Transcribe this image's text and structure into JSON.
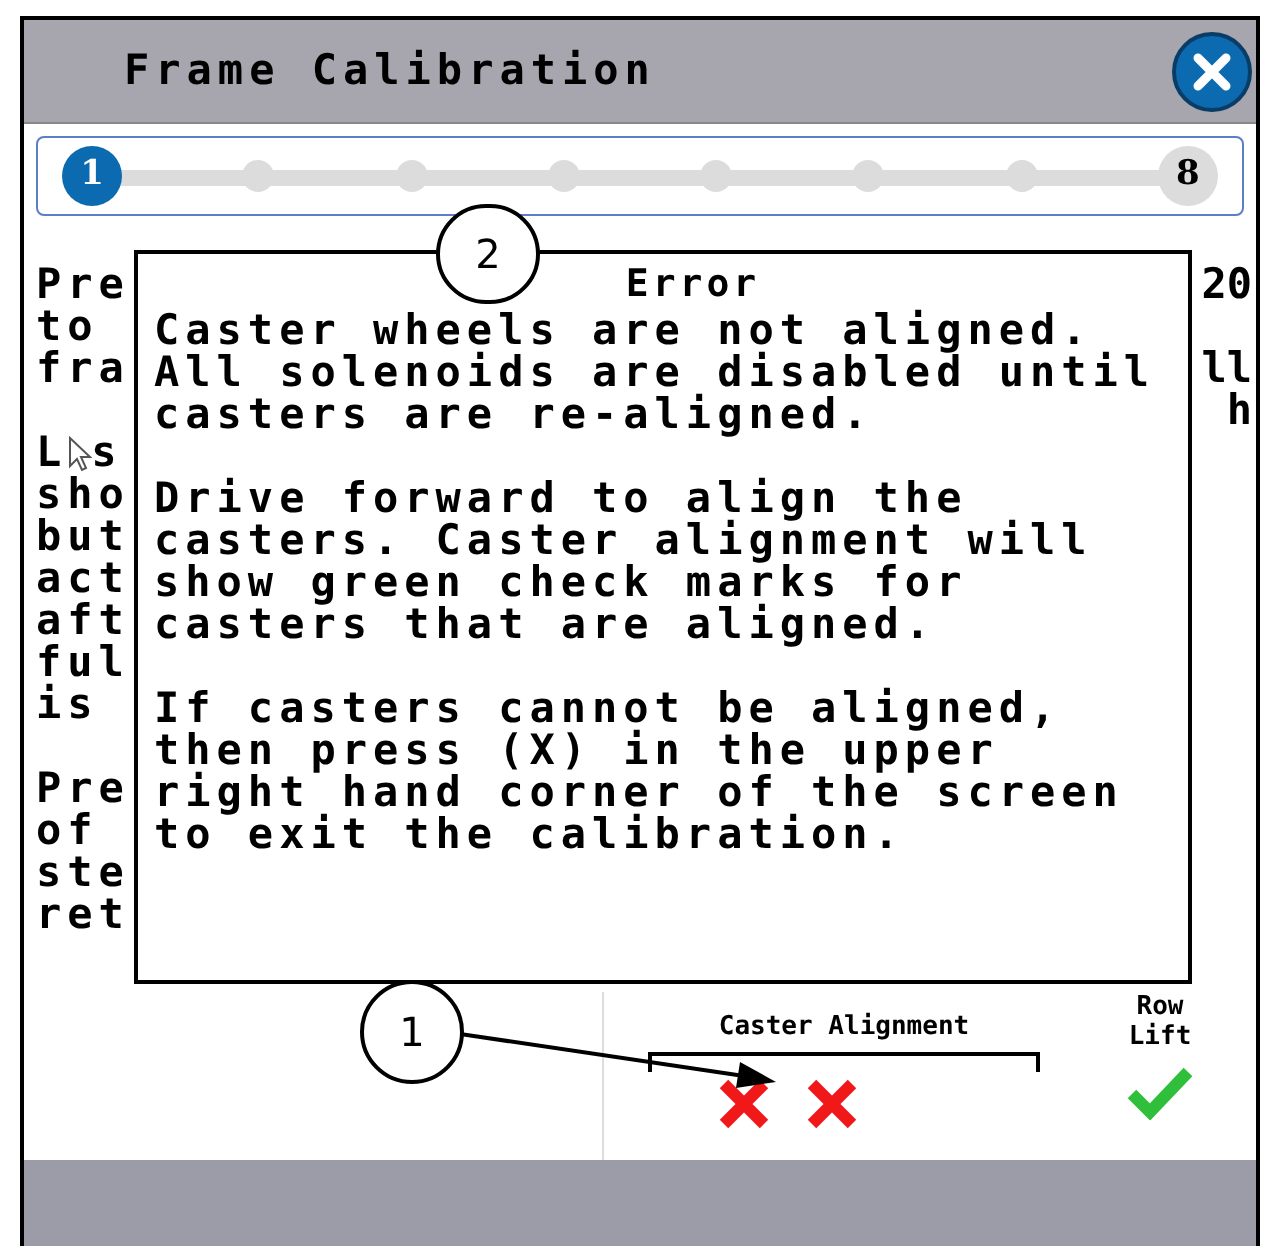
{
  "header": {
    "title": "Frame Calibration"
  },
  "stepper": {
    "steps": [
      {
        "label": "1",
        "selected": true
      },
      {
        "selected": false
      },
      {
        "selected": false
      },
      {
        "selected": false
      },
      {
        "selected": false
      },
      {
        "selected": false
      },
      {
        "selected": false
      },
      {
        "label": "8",
        "selected": false
      }
    ]
  },
  "background_text": {
    "left_lines": [
      {
        "parts": [
          "Pre"
        ]
      },
      {
        "parts": [
          "to"
        ]
      },
      {
        "parts": [
          "fra"
        ]
      },
      {
        "parts": [
          "L",
          "s"
        ],
        "gap_before": true
      },
      {
        "parts": [
          "sho"
        ]
      },
      {
        "parts": [
          "but"
        ]
      },
      {
        "parts": [
          "act"
        ]
      },
      {
        "parts": [
          "aft"
        ]
      },
      {
        "parts": [
          "ful"
        ]
      },
      {
        "parts": [
          "is"
        ]
      },
      {
        "parts": [
          "Pre"
        ],
        "gap_before": true
      },
      {
        "parts": [
          "of"
        ]
      },
      {
        "parts": [
          "ste"
        ]
      },
      {
        "parts": [
          "ret"
        ]
      }
    ],
    "right_lines": [
      {
        "text": "20"
      },
      {
        "text": "ll",
        "gap_before": true
      },
      {
        "text": "h"
      }
    ]
  },
  "dialog": {
    "title": "Error",
    "paragraphs": [
      "Caster wheels are not aligned.\nAll solenoids are disabled until\ncasters are re-aligned.",
      "Drive forward to align the\ncasters. Caster alignment will\nshow green check marks for\ncasters that are aligned.",
      "If casters cannot be aligned,\nthen press (X) in the upper\nright hand corner of the screen\nto exit the calibration."
    ]
  },
  "status": {
    "caster_alignment": {
      "label": "Caster Alignment",
      "casters": [
        {
          "aligned": false
        },
        {
          "aligned": false
        }
      ]
    },
    "row_lift": {
      "label": "Row\nLift",
      "ok": true
    }
  },
  "callouts": [
    {
      "number": "1"
    },
    {
      "number": "2"
    }
  ]
}
